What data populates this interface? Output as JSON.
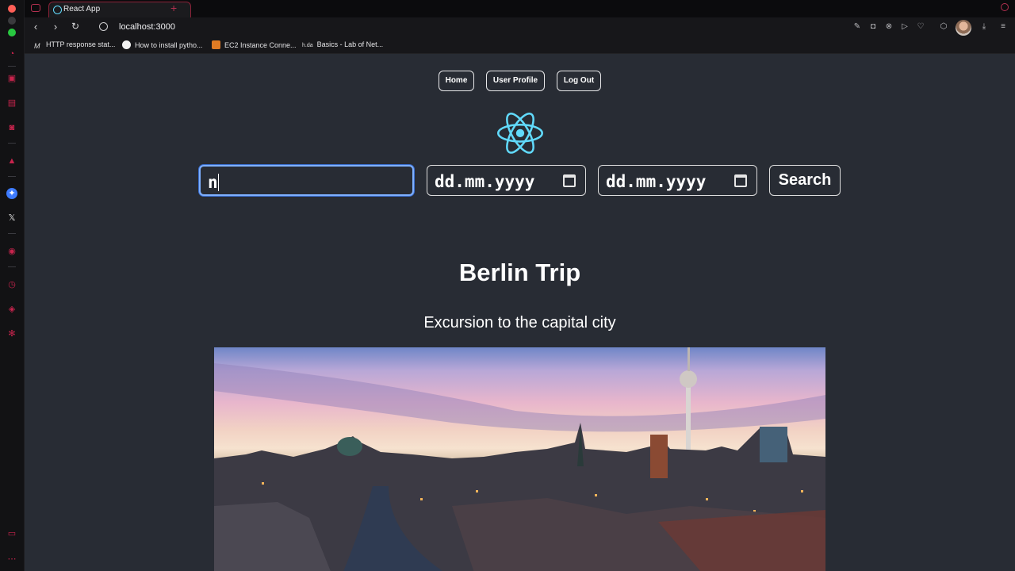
{
  "browser": {
    "tab_title": "React App",
    "url": "localhost:3000",
    "bookmarks": [
      {
        "label": "HTTP response stat...",
        "icon": "mdn-icon"
      },
      {
        "label": "How to install pytho...",
        "icon": "github-icon"
      },
      {
        "label": "EC2 Instance Conne...",
        "icon": "aws-icon"
      },
      {
        "label": "Basics - Lab of Net...",
        "icon": "hda-icon"
      }
    ],
    "bookmark_hda_prefix": "h.da"
  },
  "nav": {
    "home": "Home",
    "profile": "User Profile",
    "logout": "Log Out"
  },
  "search": {
    "query": "n",
    "date_from_placeholder": "dd.mm.yyyy",
    "date_to_placeholder": "dd.mm.yyyy",
    "button": "Search"
  },
  "trip": {
    "title": "Berlin Trip",
    "subtitle": "Excursion to the capital city"
  },
  "colors": {
    "app_bg": "#282c34",
    "react_logo": "#61dafb",
    "opera_accent": "#c8244d",
    "focus_ring": "#7fb0ff"
  }
}
